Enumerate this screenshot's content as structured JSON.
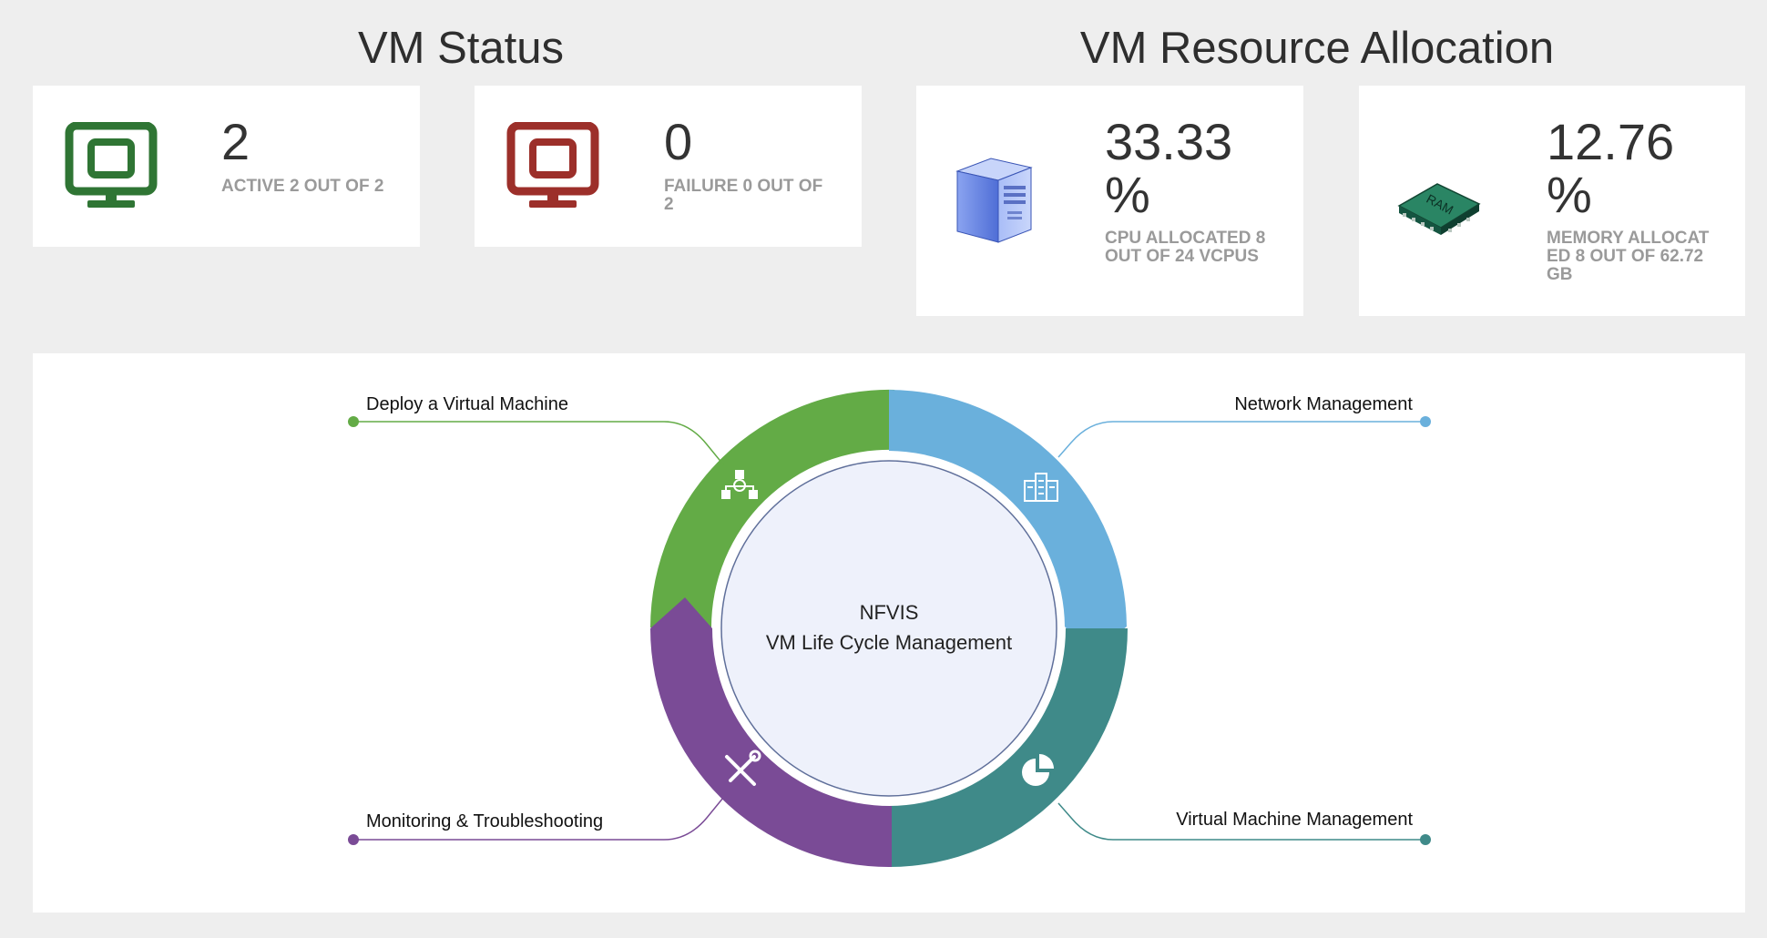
{
  "vm_status": {
    "title": "VM Status",
    "active": {
      "value": "2",
      "caption": "ACTIVE 2 OUT OF 2",
      "color": "#2f7534"
    },
    "failure": {
      "value": "0",
      "caption": "FAILURE 0 OUT OF 2",
      "color": "#9c2f2a"
    }
  },
  "vm_resource": {
    "title": "VM Resource Allocation",
    "cpu": {
      "value": "33.33",
      "unit": "%",
      "caption": "CPU ALLOCATED 8 OUT OF 24 VCPUS",
      "percent": 33.33
    },
    "memory": {
      "value": "12.76",
      "unit": "%",
      "caption": "MEMORY ALLOCATED 8 OUT OF 62.72 GB",
      "percent": 12.76,
      "chip_label": "RAM"
    }
  },
  "lifecycle": {
    "center_line1": "NFVIS",
    "center_line2": "VM Life Cycle Management",
    "segments": [
      {
        "label": "Deploy a Virtual Machine",
        "icon": "deploy-network-icon",
        "color": "#63ab46"
      },
      {
        "label": "Network Management",
        "icon": "building-icon",
        "color": "#6ab0dc"
      },
      {
        "label": "Virtual Machine Management",
        "icon": "pie-chart-icon",
        "color": "#3f8a89"
      },
      {
        "label": "Monitoring & Troubleshooting",
        "icon": "tools-icon",
        "color": "#7a4b96"
      }
    ]
  }
}
